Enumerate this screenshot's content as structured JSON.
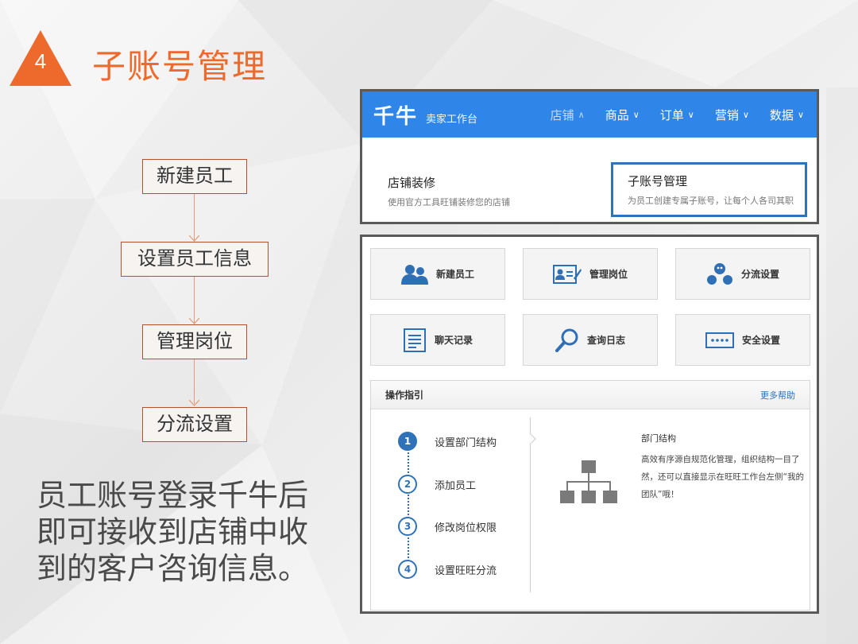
{
  "slide": {
    "number": "4",
    "title": "子账号管理",
    "accent_color": "#ee6a2c"
  },
  "flow": {
    "steps": [
      "新建员工",
      "设置员工信息",
      "管理岗位",
      "分流设置"
    ]
  },
  "description": [
    "员工账号登录千牛后",
    "即可接收到店铺中收",
    "到的客户咨询信息。"
  ],
  "app": {
    "logo": "千牛",
    "subtitle": "卖家工作台",
    "brand_color": "#2f86e8",
    "nav": [
      {
        "label": "店铺",
        "chevron": "∧"
      },
      {
        "label": "商品",
        "chevron": "∨"
      },
      {
        "label": "订单",
        "chevron": "∨"
      },
      {
        "label": "营销",
        "chevron": "∨"
      },
      {
        "label": "数据",
        "chevron": "∨"
      }
    ],
    "menu": [
      {
        "title": "店铺装修",
        "desc": "使用官方工具旺铺装修您的店铺"
      },
      {
        "title": "子账号管理",
        "desc": "为员工创建专属子账号，让每个人各司其职"
      }
    ]
  },
  "tiles": [
    {
      "label": "新建员工",
      "icon": "users-icon"
    },
    {
      "label": "管理岗位",
      "icon": "id-card-icon"
    },
    {
      "label": "分流设置",
      "icon": "split-icon"
    },
    {
      "label": "聊天记录",
      "icon": "document-icon"
    },
    {
      "label": "查询日志",
      "icon": "search-icon"
    },
    {
      "label": "安全设置",
      "icon": "password-icon"
    }
  ],
  "guide": {
    "title": "操作指引",
    "more": "更多帮助",
    "steps": [
      {
        "num": "1",
        "label": "设置部门结构"
      },
      {
        "num": "2",
        "label": "添加员工"
      },
      {
        "num": "3",
        "label": "修改岗位权限"
      },
      {
        "num": "4",
        "label": "设置旺旺分流"
      }
    ],
    "info_title": "部门结构",
    "info_text": "高效有序源自规范化管理，组织结构一目了然，还可以直接显示在旺旺工作台左侧“我的团队”哦！"
  }
}
